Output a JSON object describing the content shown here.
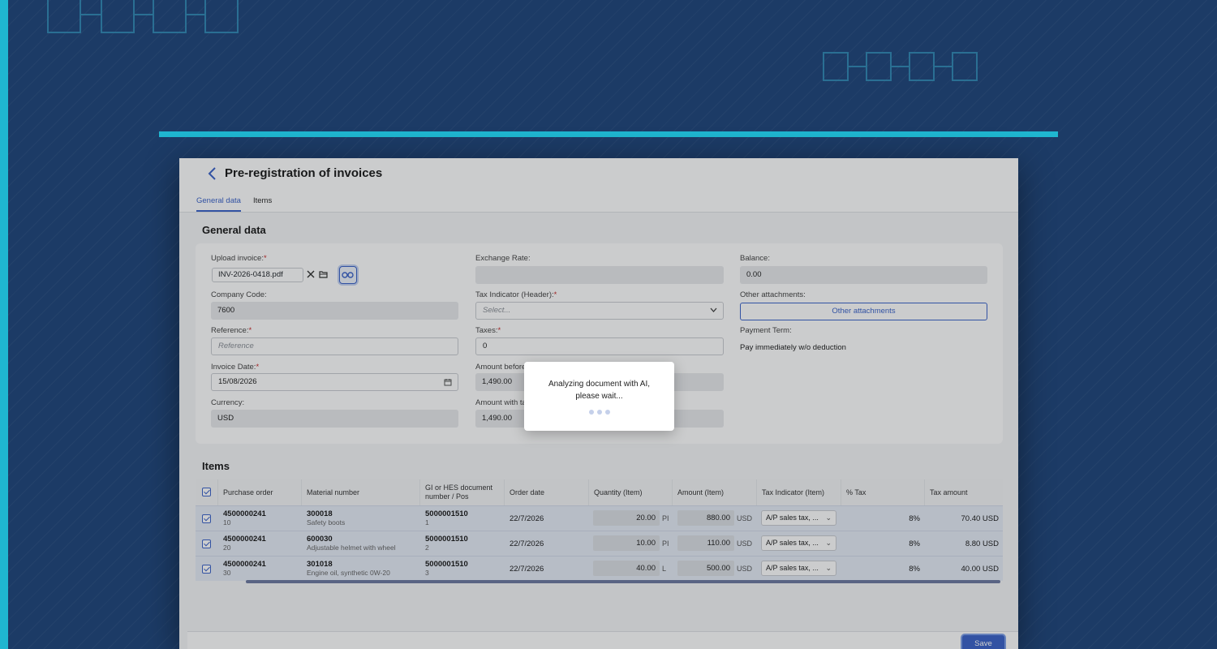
{
  "page": {
    "title": "Pre-registration of invoices",
    "tabs": [
      {
        "label": "General data",
        "active": true
      },
      {
        "label": "Items",
        "active": false
      }
    ]
  },
  "general": {
    "section_title": "General data",
    "upload_invoice": {
      "label": "Upload invoice:",
      "required_mark": "*",
      "filename": "INV-2026-0418.pdf"
    },
    "company_code": {
      "label": "Company Code:",
      "value": "7600"
    },
    "reference": {
      "label": "Reference:",
      "required_mark": "*",
      "placeholder": "Reference"
    },
    "invoice_date": {
      "label": "Invoice Date:",
      "required_mark": "*",
      "value": "15/08/2026"
    },
    "currency": {
      "label": "Currency:",
      "value": "USD"
    },
    "exchange_rate": {
      "label": "Exchange Rate:",
      "value": ""
    },
    "tax_indicator": {
      "label": "Tax Indicator (Header):",
      "required_mark": "*",
      "placeholder": "Select..."
    },
    "taxes": {
      "label": "Taxes:",
      "required_mark": "*",
      "value": "0"
    },
    "amount_before": {
      "label": "Amount before",
      "value": "1,490.00"
    },
    "amount_with": {
      "label": "Amount with ta",
      "value": "1,490.00"
    },
    "balance": {
      "label": "Balance:",
      "value": "0.00"
    },
    "other_attachments": {
      "label": "Other attachments:",
      "button": "Other attachments"
    },
    "payment_term": {
      "label": "Payment Term:",
      "value": "Pay immediately w/o deduction"
    }
  },
  "items": {
    "section_title": "Items",
    "columns": [
      "Purchase order",
      "Material number",
      "GI or HES document number / Pos",
      "Order date",
      "Quantity (Item)",
      "Amount (Item)",
      "Tax Indicator (Item)",
      "% Tax",
      "Tax amount"
    ],
    "rows": [
      {
        "po": "4500000241",
        "po_pos": "10",
        "material": "300018",
        "material_desc": "Safety boots",
        "doc": "5000001510",
        "doc_pos": "1",
        "order_date": "22/7/2026",
        "qty": "20.00",
        "qty_unit": "PI",
        "amount": "880.00",
        "amount_cur": "USD",
        "tax_ind": "A/P sales tax, ...",
        "pct_tax": "8%",
        "tax_amount": "70.40 USD"
      },
      {
        "po": "4500000241",
        "po_pos": "20",
        "material": "600030",
        "material_desc": "Adjustable helmet with wheel",
        "doc": "5000001510",
        "doc_pos": "2",
        "order_date": "22/7/2026",
        "qty": "10.00",
        "qty_unit": "PI",
        "amount": "110.00",
        "amount_cur": "USD",
        "tax_ind": "A/P sales tax, ...",
        "pct_tax": "8%",
        "tax_amount": "8.80 USD"
      },
      {
        "po": "4500000241",
        "po_pos": "30",
        "material": "301018",
        "material_desc": "Engine oil, synthetic 0W-20",
        "doc": "5000001510",
        "doc_pos": "3",
        "order_date": "22/7/2026",
        "qty": "40.00",
        "qty_unit": "L",
        "amount": "500.00",
        "amount_cur": "USD",
        "tax_ind": "A/P sales tax, ...",
        "pct_tax": "8%",
        "tax_amount": "40.00 USD"
      }
    ]
  },
  "footer": {
    "save_label": "Save"
  },
  "modal": {
    "line1": "Analyzing document with AI,",
    "line2": "please wait..."
  },
  "colors": {
    "background": "#1c3b66",
    "accent_cyan": "#1fb6d0",
    "primary": "#3b63c9"
  }
}
